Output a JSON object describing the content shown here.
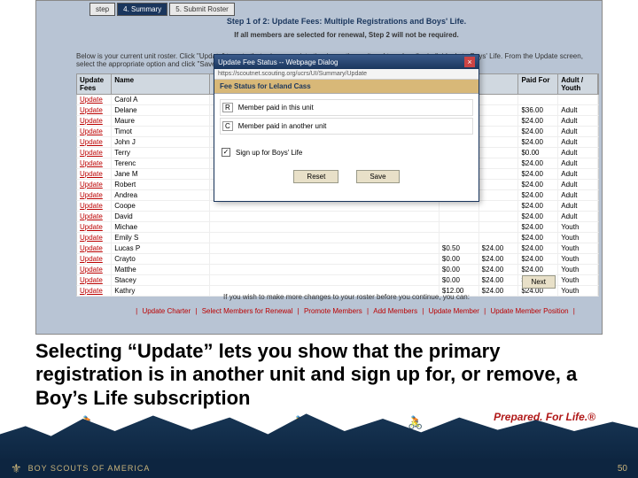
{
  "wizard": {
    "tab_step": "step",
    "tab4": "4. Summary",
    "tab5": "5. Submit Roster"
  },
  "step": {
    "title": "Step 1 of 2: Update Fees: Multiple Registrations and Boys' Life.",
    "note": "If all members are selected for renewal, Step 2 will not be required.",
    "instructions": "Below is your current unit roster. Click \"Update\" to note that primary registration is another unit and to subscribe individuals to Boys' Life. From the Update screen, select the appropriate option and click \"Save\" to retain and pay no registration fee."
  },
  "columns": {
    "update": "Update Fees",
    "name": "Name",
    "fee": "",
    "bl": "",
    "paid": "Paid For",
    "ay": "Adult / Youth"
  },
  "rows": [
    {
      "name": "Carol A",
      "fee": "",
      "bl": "",
      "paid": "",
      "ay": ""
    },
    {
      "name": "Delane",
      "fee": "",
      "bl": "",
      "paid": "$36.00",
      "ay": "Adult"
    },
    {
      "name": "Maure",
      "fee": "",
      "bl": "",
      "paid": "$24.00",
      "ay": "Adult"
    },
    {
      "name": "Timot",
      "fee": "",
      "bl": "",
      "paid": "$24.00",
      "ay": "Adult"
    },
    {
      "name": "John J",
      "fee": "",
      "bl": "",
      "paid": "$24.00",
      "ay": "Adult"
    },
    {
      "name": "Terry",
      "fee": "",
      "bl": "",
      "paid": "$0.00",
      "ay": "Adult"
    },
    {
      "name": "Terenc",
      "fee": "",
      "bl": "",
      "paid": "$24.00",
      "ay": "Adult"
    },
    {
      "name": "Jane M",
      "fee": "",
      "bl": "",
      "paid": "$24.00",
      "ay": "Adult"
    },
    {
      "name": "Robert",
      "fee": "",
      "bl": "",
      "paid": "$24.00",
      "ay": "Adult"
    },
    {
      "name": "Andrea",
      "fee": "",
      "bl": "",
      "paid": "$24.00",
      "ay": "Adult"
    },
    {
      "name": "Coope",
      "fee": "",
      "bl": "",
      "paid": "$24.00",
      "ay": "Adult"
    },
    {
      "name": "David",
      "fee": "",
      "bl": "",
      "paid": "$24.00",
      "ay": "Adult"
    },
    {
      "name": "Michae",
      "fee": "",
      "bl": "",
      "paid": "$24.00",
      "ay": "Youth"
    },
    {
      "name": "Emily S",
      "fee": "",
      "bl": "",
      "paid": "$24.00",
      "ay": "Youth"
    },
    {
      "name": "Lucas P",
      "fee": "$0.50",
      "bl": "$24.00",
      "paid": "$24.00",
      "ay": "Youth"
    },
    {
      "name": "Crayto",
      "fee": "$0.00",
      "bl": "$24.00",
      "paid": "$24.00",
      "ay": "Youth"
    },
    {
      "name": "Matthe",
      "fee": "$0.00",
      "bl": "$24.00",
      "paid": "$24.00",
      "ay": "Youth"
    },
    {
      "name": "Stacey",
      "fee": "$0.00",
      "bl": "$24.00",
      "paid": "$24.00",
      "ay": "Youth"
    },
    {
      "name": "Kathry",
      "fee": "$12.00",
      "bl": "$24.00",
      "paid": "$24.00",
      "ay": "Youth"
    }
  ],
  "update_label": "Update",
  "dialog": {
    "title": "Update Fee Status -- Webpage Dialog",
    "url": "https://scoutnet.scouting.org/ucrs/UI/Summary/Update",
    "header": "Fee Status for Leland Cass",
    "opt1": "Member paid in this unit",
    "opt1_code": "R",
    "opt2": "Member paid in another unit",
    "opt2_code": "C",
    "bl_label": "Sign up for Boys' Life",
    "reset": "Reset",
    "save": "Save"
  },
  "more_changes": "If you wish to make more changes to your roster before you continue, you can:",
  "actions": {
    "a": "Update Charter",
    "b": "Select Members for Renewal",
    "c": "Promote Members",
    "d": "Add Members",
    "e": "Update Member",
    "f": "Update Member Position"
  },
  "next": "Next",
  "caption": "Selecting “Update” lets you show that the primary registration is in another unit and sign up for, or remove, a Boy’s Life subscription",
  "tagline": "Prepared. For Life.®",
  "footer": {
    "org": "BOY SCOUTS OF AMERICA",
    "page": "50"
  }
}
